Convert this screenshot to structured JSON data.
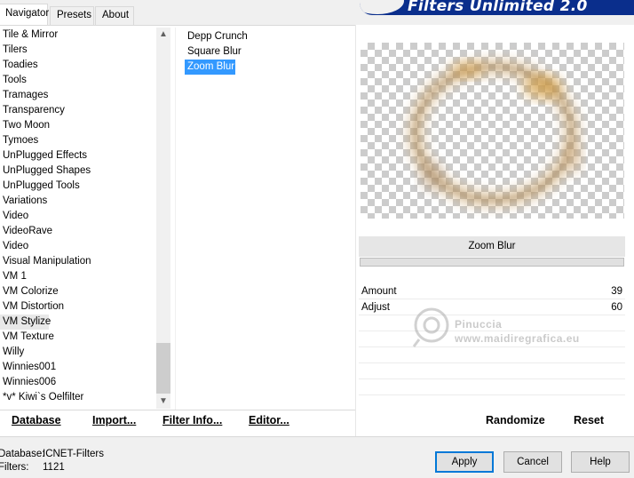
{
  "tabs": [
    {
      "label": "Navigator",
      "active": true
    },
    {
      "label": "Presets",
      "active": false
    },
    {
      "label": "About",
      "active": false
    }
  ],
  "banner": {
    "title": "Filters Unlimited 2.0"
  },
  "categories": [
    "Tile & Mirror",
    "Tilers",
    "Toadies",
    "Tools",
    "Tramages",
    "Transparency",
    "Two Moon",
    "Tymoes",
    "UnPlugged Effects",
    "UnPlugged Shapes",
    "UnPlugged Tools",
    "Variations",
    "Video",
    "VideoRave",
    "Video",
    "Visual Manipulation",
    "VM 1",
    "VM Colorize",
    "VM Distortion",
    "VM Stylize",
    "VM Texture",
    "Willy",
    "Winnies001",
    "Winnies006",
    "*v* Kiwi`s Oelfilter"
  ],
  "selected_category": "VM Stylize",
  "filters": [
    "Depp Crunch",
    "Square Blur",
    "Zoom Blur"
  ],
  "selected_filter": "Zoom Blur",
  "left_buttons": {
    "database": "Database",
    "import": "Import...",
    "filter_info": "Filter Info...",
    "editor": "Editor..."
  },
  "right_buttons": {
    "randomize": "Randomize",
    "reset": "Reset"
  },
  "filter_title": "Zoom Blur",
  "params": [
    {
      "label": "Amount",
      "value": "39"
    },
    {
      "label": "Adjust",
      "value": "60"
    }
  ],
  "watermark": {
    "name": "Pinuccia",
    "site": "www.maidiregrafica.eu"
  },
  "status": {
    "database_label": "Database:",
    "database_value": "ICNET-Filters",
    "filters_label": "Filters:",
    "filters_value": "1121"
  },
  "dialog_buttons": {
    "apply": "Apply",
    "cancel": "Cancel",
    "help": "Help"
  },
  "colors": {
    "banner": "#0a2e8c",
    "selection": "#3399ff",
    "default_button_border": "#0078d7"
  }
}
